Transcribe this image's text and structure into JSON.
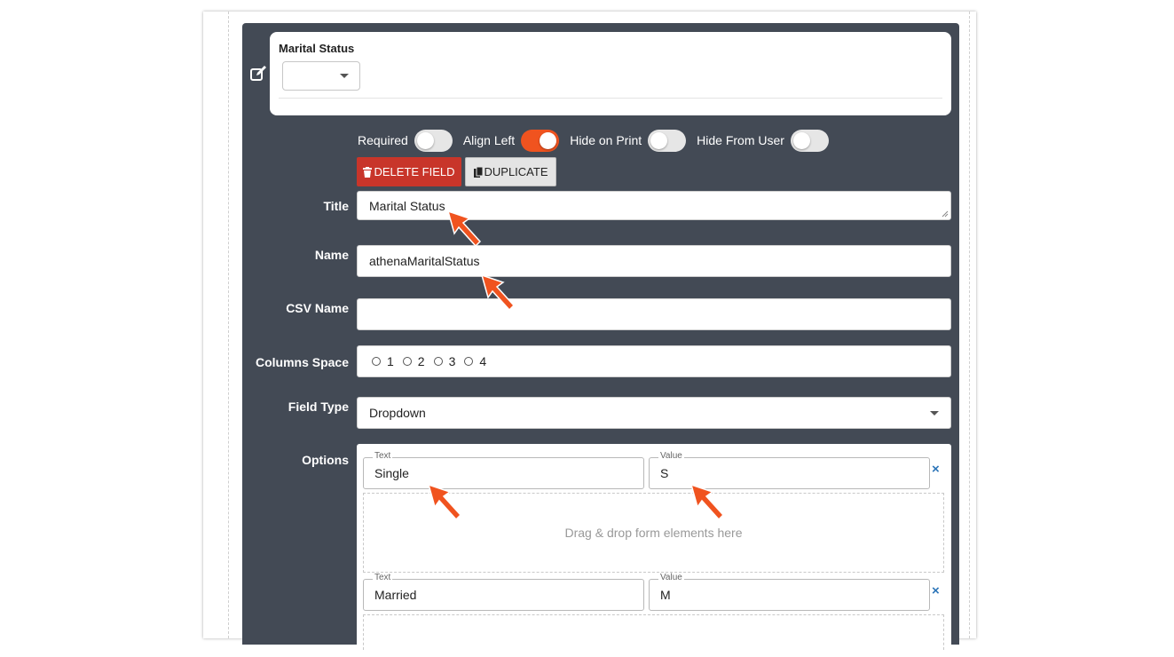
{
  "preview": {
    "label": "Marital Status",
    "selected": ""
  },
  "toggles": [
    {
      "label": "Required",
      "on": false
    },
    {
      "label": "Align Left",
      "on": true
    },
    {
      "label": "Hide on Print",
      "on": false
    },
    {
      "label": "Hide From User",
      "on": false
    }
  ],
  "actions": {
    "delete_label": "DELETE FIELD",
    "duplicate_label": "DUPLICATE"
  },
  "form": {
    "title": {
      "label": "Title",
      "value": "Marital Status"
    },
    "name": {
      "label": "Name",
      "value": "athenaMaritalStatus"
    },
    "csv_name": {
      "label": "CSV Name",
      "value": ""
    },
    "columns": {
      "label": "Columns Space",
      "options": [
        "1",
        "2",
        "3",
        "4"
      ]
    },
    "field_type": {
      "label": "Field Type",
      "value": "Dropdown"
    },
    "options": {
      "label": "Options",
      "text_label": "Text",
      "value_label": "Value",
      "items": [
        {
          "text": "Single",
          "value": "S"
        },
        {
          "text": "Married",
          "value": "M"
        }
      ],
      "dropzone_text": "Drag & drop form elements here",
      "remove_glyph": "×"
    }
  },
  "colors": {
    "panel": "#434a55",
    "accent": "#f0531f",
    "delete": "#c8352a",
    "remove": "#2c75b8"
  },
  "icons": [
    "edit-icon",
    "trash-icon",
    "copy-icon",
    "chevron-down-icon",
    "close-icon",
    "pointer-arrow-icon"
  ]
}
